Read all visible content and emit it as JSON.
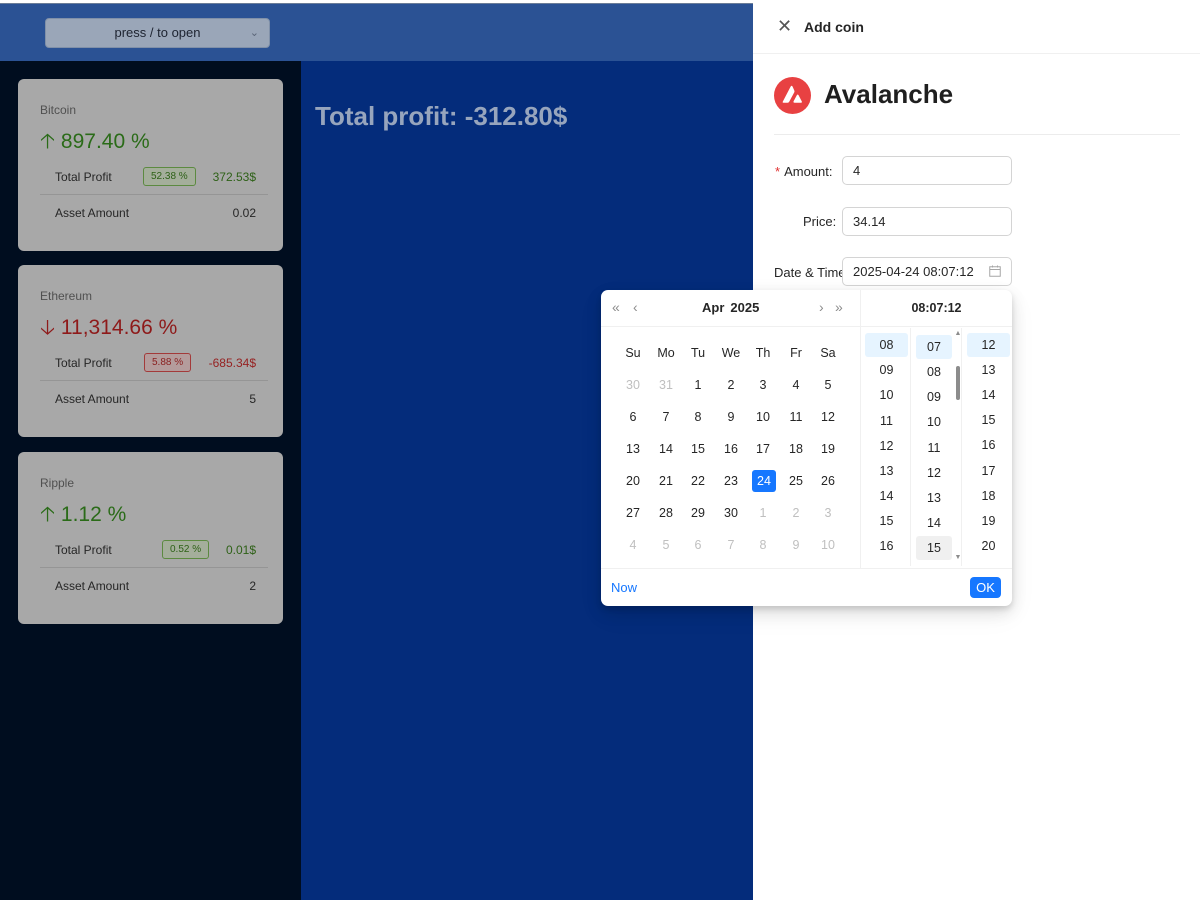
{
  "header": {
    "search_placeholder": "press / to open"
  },
  "main": {
    "total_profit": "Total profit: -312.80$"
  },
  "coins": [
    {
      "name": "Bitcoin",
      "direction": "up",
      "percent": "897.40 %",
      "total_profit_label": "Total Profit",
      "profit_badge": "52.38 %",
      "profit_value": "372.53$",
      "asset_amount_label": "Asset Amount",
      "asset_amount": "0.02"
    },
    {
      "name": "Ethereum",
      "direction": "down",
      "percent": "11,314.66 %",
      "total_profit_label": "Total Profit",
      "profit_badge": "5.88 %",
      "profit_value": "-685.34$",
      "asset_amount_label": "Asset Amount",
      "asset_amount": "5"
    },
    {
      "name": "Ripple",
      "direction": "up",
      "percent": "1.12 %",
      "total_profit_label": "Total Profit",
      "profit_badge": "0.52 %",
      "profit_value": "0.01$",
      "asset_amount_label": "Asset Amount",
      "asset_amount": "2"
    }
  ],
  "drawer": {
    "title": "Add coin",
    "coin_name": "Avalanche",
    "form": {
      "amount_label": "Amount",
      "amount_value": "4",
      "price_label": "Price",
      "price_value": "34.14",
      "datetime_label": "Date & Time",
      "datetime_value": "2025-04-24 08:07:12"
    }
  },
  "picker": {
    "month": "Apr",
    "year": "2025",
    "weekdays": [
      "Su",
      "Mo",
      "Tu",
      "We",
      "Th",
      "Fr",
      "Sa"
    ],
    "weeks": [
      [
        "30",
        "31",
        "1",
        "2",
        "3",
        "4",
        "5"
      ],
      [
        "6",
        "7",
        "8",
        "9",
        "10",
        "11",
        "12"
      ],
      [
        "13",
        "14",
        "15",
        "16",
        "17",
        "18",
        "19"
      ],
      [
        "20",
        "21",
        "22",
        "23",
        "24",
        "25",
        "26"
      ],
      [
        "27",
        "28",
        "29",
        "30",
        "1",
        "2",
        "3"
      ],
      [
        "4",
        "5",
        "6",
        "7",
        "8",
        "9",
        "10"
      ]
    ],
    "selected_day": "24",
    "time_display": "08:07:12",
    "hours": [
      "08",
      "09",
      "10",
      "11",
      "12",
      "13",
      "14",
      "15",
      "16"
    ],
    "minutes": [
      "07",
      "08",
      "09",
      "10",
      "11",
      "12",
      "13",
      "14",
      "15"
    ],
    "seconds": [
      "12",
      "13",
      "14",
      "15",
      "16",
      "17",
      "18",
      "19",
      "20"
    ],
    "now_label": "Now",
    "ok_label": "OK"
  },
  "colors": {
    "accent": "#1677ff",
    "profit_up": "#2a6b18",
    "profit_down": "#8e1a1a",
    "avalanche_brand": "#e84142"
  }
}
